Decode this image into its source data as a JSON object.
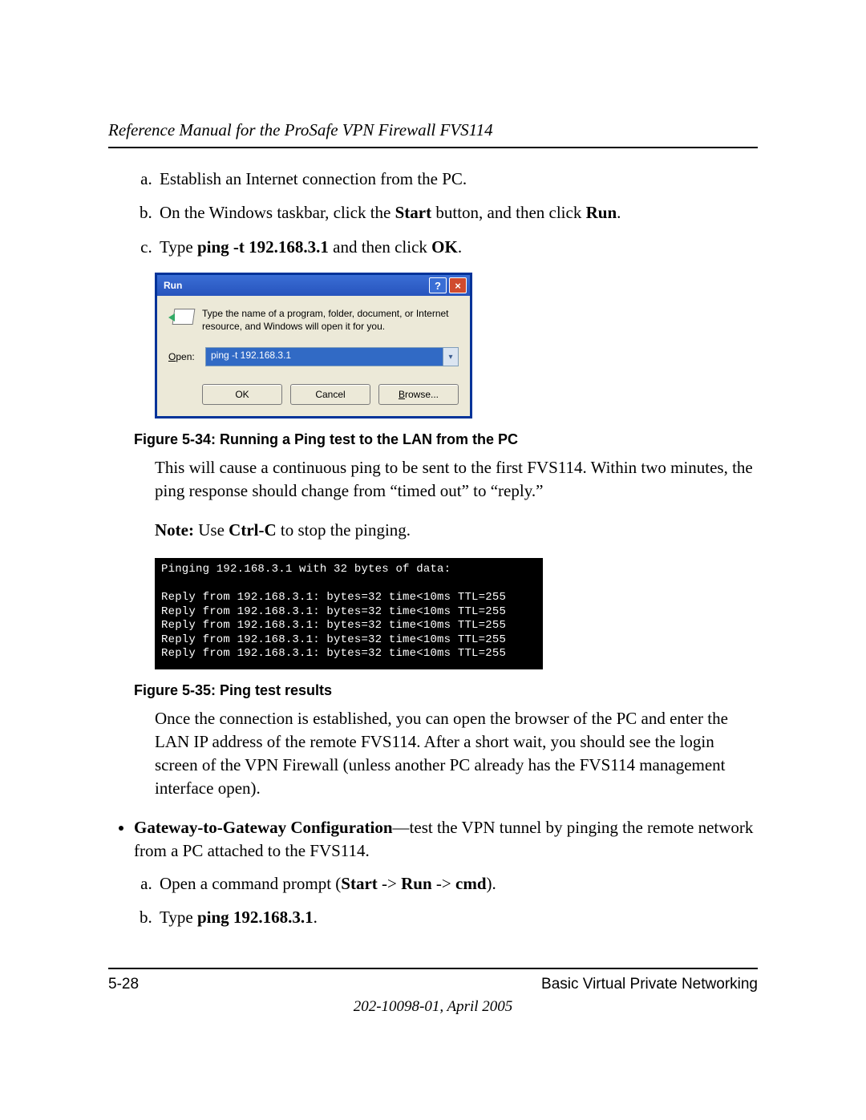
{
  "header": {
    "title": "Reference Manual for the ProSafe VPN Firewall FVS114"
  },
  "steps_first": {
    "a": "Establish an Internet connection from the PC.",
    "b_pre": "On the Windows taskbar, click the ",
    "b_start": "Start",
    "b_mid": " button, and then click ",
    "b_run": "Run",
    "b_post": ".",
    "c_pre": "Type  ",
    "c_cmd": "ping -t 192.168.3.1",
    "c_mid": "  and then click ",
    "c_ok": "OK",
    "c_post": "."
  },
  "run_dialog": {
    "title": "Run",
    "help_glyph": "?",
    "close_glyph": "×",
    "message": "Type the name of a program, folder, document, or Internet resource, and Windows will open it for you.",
    "open_label_pre": "O",
    "open_label_post": "pen:",
    "input_value": "ping -t 192.168.3.1",
    "dropdown_glyph": "▾",
    "buttons": {
      "ok": "OK",
      "cancel": "Cancel",
      "browse": "Browse..."
    }
  },
  "figures": {
    "f34": "Figure 5-34:  Running a Ping test to the LAN from the PC",
    "f35": "Figure 5-35:  Ping test results"
  },
  "paras": {
    "p1": "This will cause a continuous ping to be sent to the first FVS114. Within two minutes, the ping response should change from “timed out” to “reply.”",
    "note_label": "Note:",
    "note_pre": " Use ",
    "note_key": "Ctrl-C",
    "note_post": " to stop the pinging.",
    "p2": "Once the connection is established, you can open the browser of the PC and enter the LAN IP address of the remote FVS114. After a short wait, you should see the login screen of the VPN Firewall (unless another PC already has the FVS114 management interface open)."
  },
  "cmd_output": "Pinging 192.168.3.1 with 32 bytes of data:\n\nReply from 192.168.3.1: bytes=32 time<10ms TTL=255\nReply from 192.168.3.1: bytes=32 time<10ms TTL=255\nReply from 192.168.3.1: bytes=32 time<10ms TTL=255\nReply from 192.168.3.1: bytes=32 time<10ms TTL=255\nReply from 192.168.3.1: bytes=32 time<10ms TTL=255",
  "gateway": {
    "bullet_title": "Gateway-to-Gateway Configuration",
    "bullet_rest": "—test the VPN tunnel by pinging the remote network from a PC attached to the FVS114.",
    "a_pre": "Open a command prompt (",
    "a_start": "Start",
    "a_arrow1": " -> ",
    "a_run": "Run",
    "a_arrow2": " -> ",
    "a_cmd": "cmd",
    "a_post": ").",
    "b_pre": "Type ",
    "b_cmd": "ping 192.168.3.1",
    "b_post": "."
  },
  "footer": {
    "page": "5-28",
    "section": "Basic Virtual Private Networking",
    "docid": "202-10098-01, April 2005"
  }
}
